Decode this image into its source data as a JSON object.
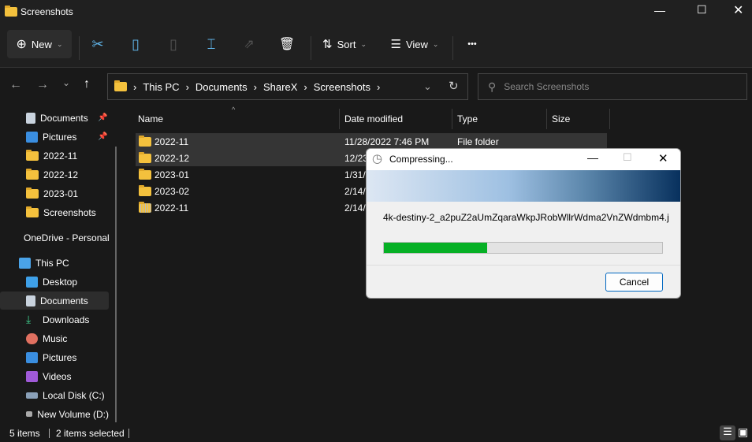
{
  "window": {
    "title": "Screenshots"
  },
  "toolbar": {
    "new_label": "New",
    "sort_label": "Sort",
    "view_label": "View",
    "more": "•••"
  },
  "address": {
    "crumbs": [
      "This PC",
      "Documents",
      "ShareX",
      "Screenshots"
    ]
  },
  "search": {
    "placeholder": "Search Screenshots"
  },
  "sidebar": {
    "items": [
      {
        "label": "Documents",
        "icon": "documents-icon",
        "pinned": true
      },
      {
        "label": "Pictures",
        "icon": "pictures-icon",
        "pinned": true
      },
      {
        "label": "2022-11",
        "icon": "folder-icon"
      },
      {
        "label": "2022-12",
        "icon": "folder-icon"
      },
      {
        "label": "2023-01",
        "icon": "folder-icon"
      },
      {
        "label": "Screenshots",
        "icon": "folder-icon"
      },
      {
        "label": "OneDrive - Personal",
        "icon": "onedrive-icon"
      },
      {
        "label": "This PC",
        "icon": "pc-icon"
      },
      {
        "label": "Desktop",
        "icon": "desktop-icon"
      },
      {
        "label": "Documents",
        "icon": "documents-icon"
      },
      {
        "label": "Downloads",
        "icon": "downloads-icon"
      },
      {
        "label": "Music",
        "icon": "music-icon"
      },
      {
        "label": "Pictures",
        "icon": "pictures-icon"
      },
      {
        "label": "Videos",
        "icon": "videos-icon"
      },
      {
        "label": "Local Disk (C:)",
        "icon": "drive-icon"
      },
      {
        "label": "New Volume (D:)",
        "icon": "drive-icon"
      }
    ]
  },
  "columns": {
    "name": "Name",
    "date": "Date modified",
    "type": "Type",
    "size": "Size"
  },
  "files": [
    {
      "name": "2022-11",
      "date": "11/28/2022 7:46 PM",
      "type": "File folder",
      "selected": true
    },
    {
      "name": "2022-12",
      "date": "12/23",
      "type": "",
      "selected": true
    },
    {
      "name": "2023-01",
      "date": "1/31/",
      "type": ""
    },
    {
      "name": "2023-02",
      "date": "2/14/",
      "type": ""
    },
    {
      "name": "2022-11",
      "date": "2/14/",
      "type": "",
      "zip": true
    }
  ],
  "dialog": {
    "title": "Compressing...",
    "filename": "4k-destiny-2_a2puZ2aUmZqaraWkpJRobWllrWdma2VnZWdmbm4.j",
    "progress_percent": 37,
    "cancel_label": "Cancel"
  },
  "status": {
    "count": "5 items",
    "selected": "2 items selected"
  }
}
